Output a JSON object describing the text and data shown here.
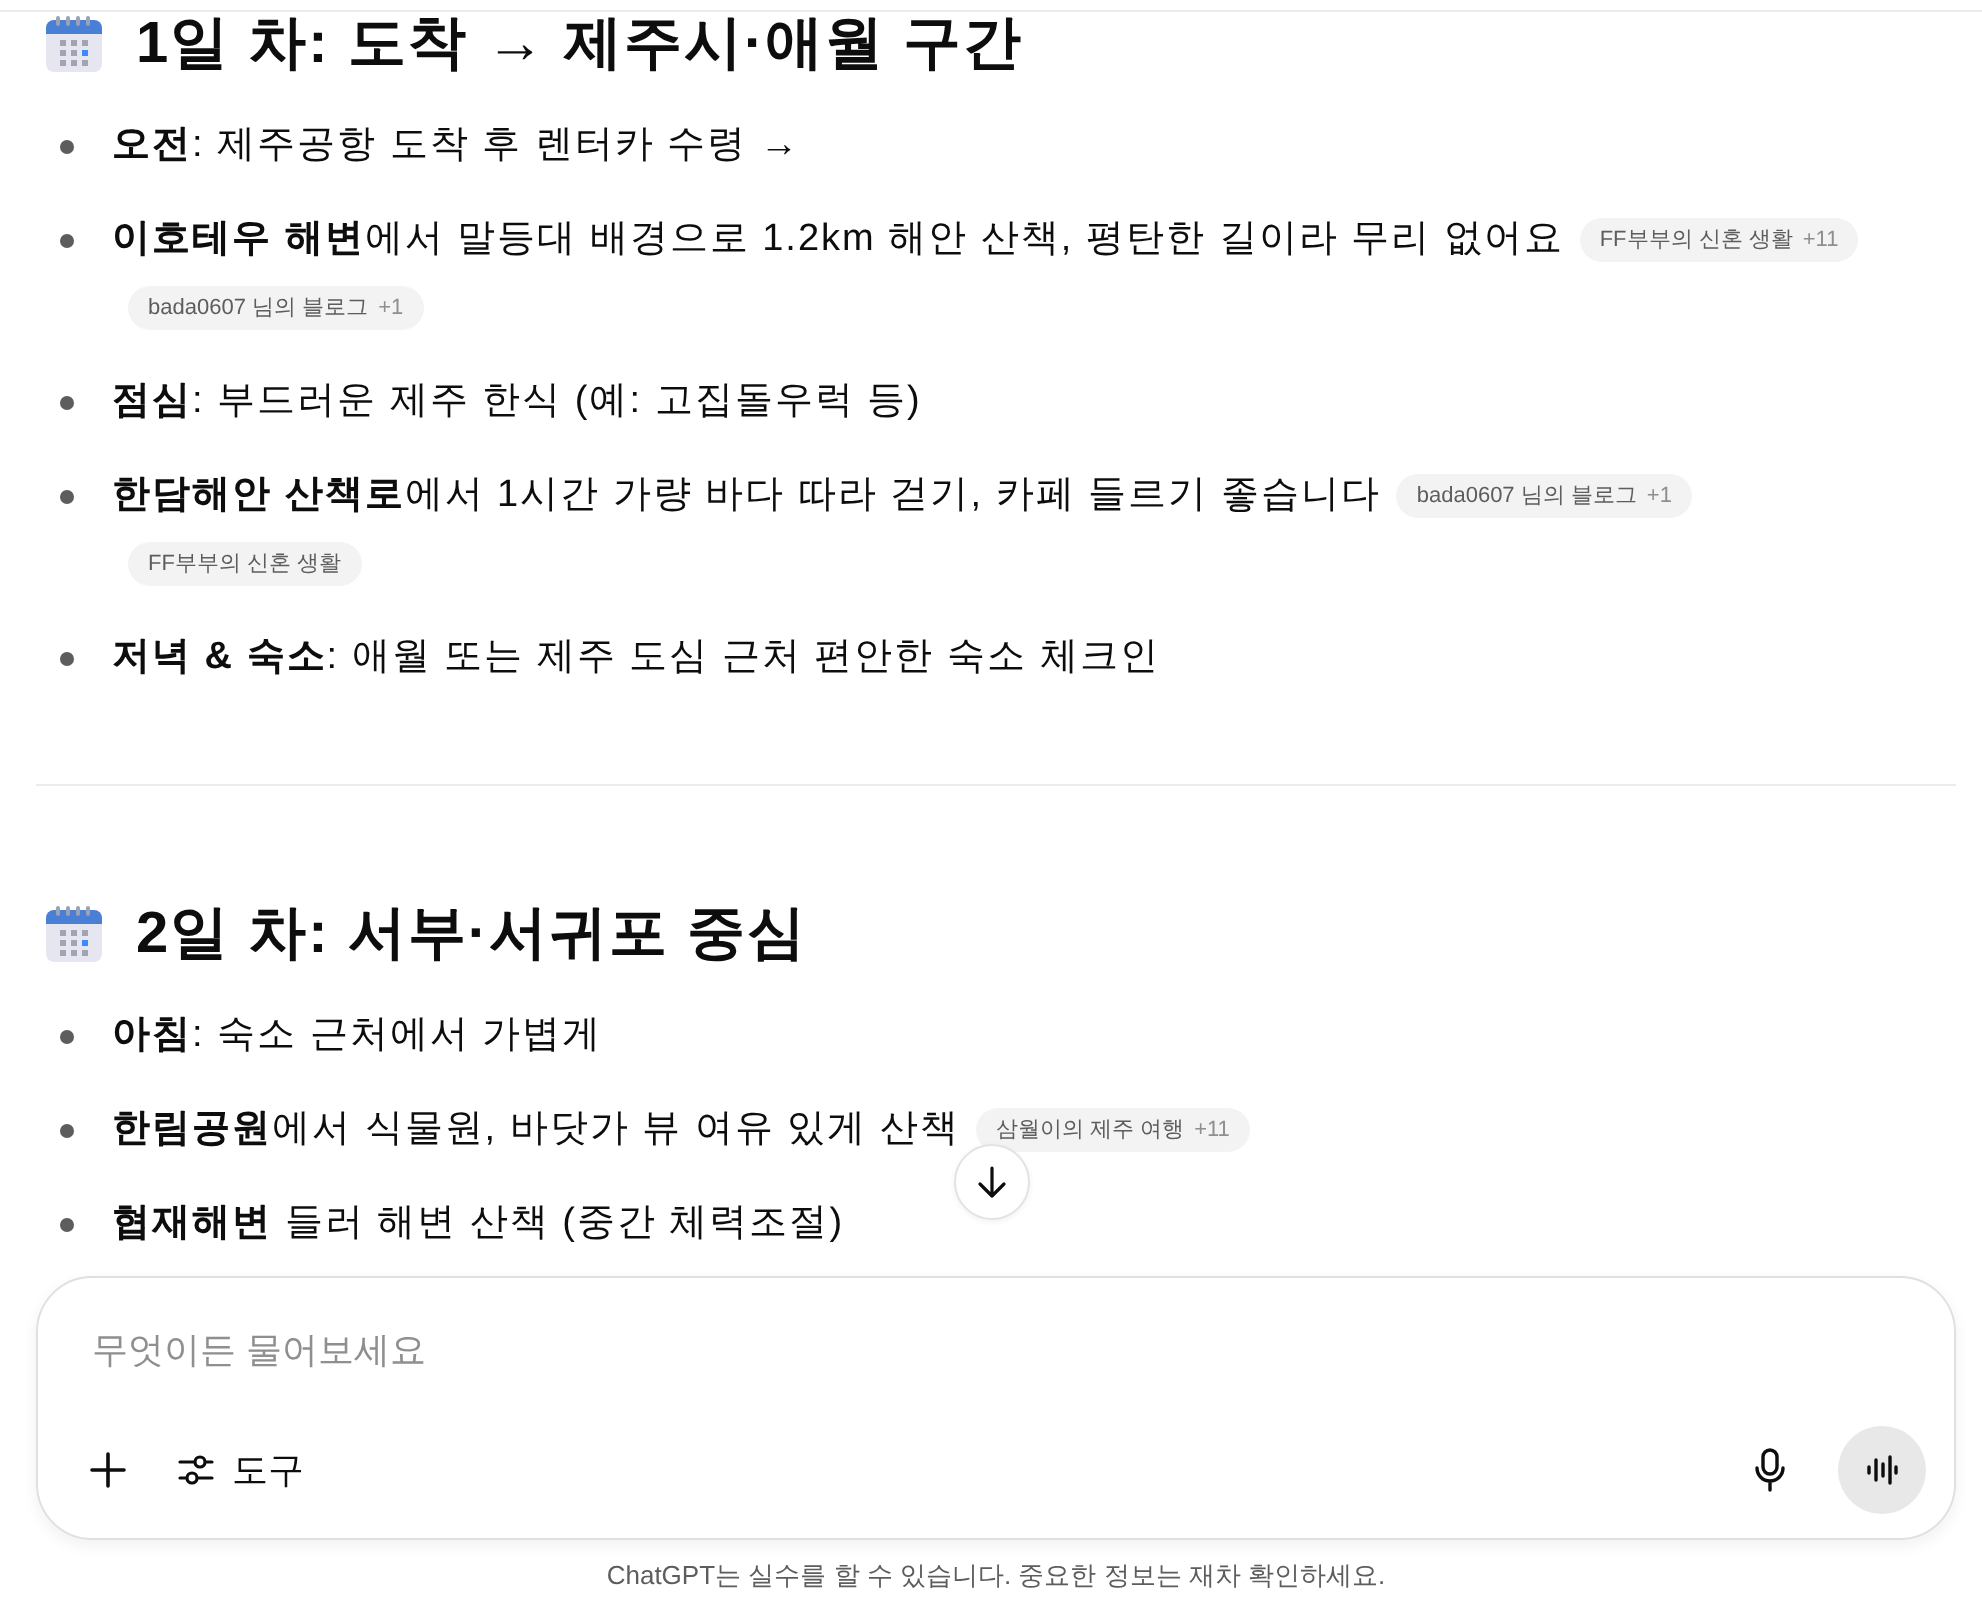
{
  "sections": [
    {
      "title": "1일 차: 도착 → 제주시·애월 구간",
      "items": [
        {
          "text": "**오전**: 제주공항 도착 후 렌터카 수령 →"
        },
        {
          "text": "**이호테우 해변**에서 말등대 배경으로 1.2km 해안 산책, 평탄한 길이라 무리 없어요",
          "sources": [
            {
              "name": "FF부부의 신혼 생활",
              "count": "+11"
            },
            {
              "name": "bada0607 님의 블로그",
              "count": "+1"
            }
          ]
        },
        {
          "text": "**점심**: 부드러운 제주 한식 (예: 고집돌우럭 등)"
        },
        {
          "text": "**한담해안 산책로**에서 1시간 가량 바다 따라 걷기, 카페 들르기 좋습니다",
          "sources": [
            {
              "name": "bada0607 님의 블로그",
              "count": "+1"
            },
            {
              "name": "FF부부의 신혼 생활"
            }
          ]
        },
        {
          "text": "**저녁 & 숙소**: 애월 또는 제주 도심 근처 편안한 숙소 체크인"
        }
      ]
    },
    {
      "title": "2일 차: 서부·서귀포 중심",
      "items": [
        {
          "text": "**아침**: 숙소 근처에서 가볍게"
        },
        {
          "text": "**한림공원**에서 식물원, 바닷가 뷰 여유 있게 산책",
          "sources": [
            {
              "name": "삼월이의 제주 여행",
              "count": "+11"
            }
          ]
        },
        {
          "text": "**협재해변** 들러 해변 산책 (중간 체력조절)"
        }
      ]
    }
  ],
  "composer": {
    "placeholder": "무엇이든 물어보세요",
    "tools_label": "도구"
  },
  "footer": "ChatGPT는 실수를 할 수 있습니다. 중요한 정보는 재차 확인하세요."
}
